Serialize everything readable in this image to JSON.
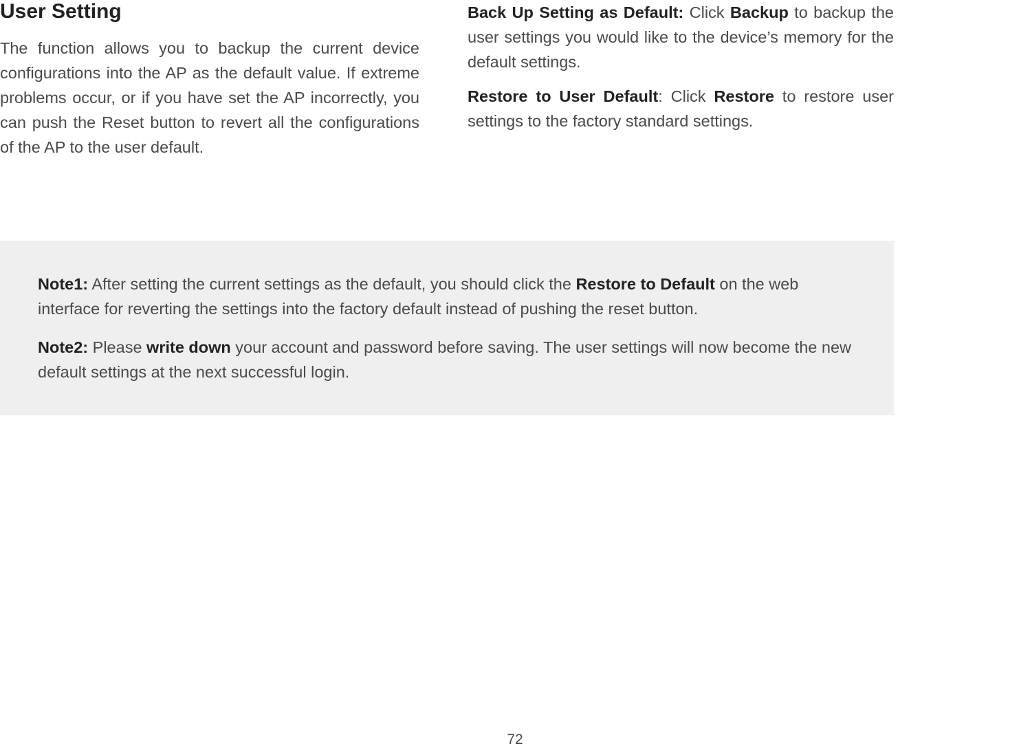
{
  "left": {
    "title": "User Setting",
    "para": "The function allows you to backup the current device configurations into the AP as the default value. If extreme problems occur, or if you have set the AP incorrectly, you can push the Reset button to revert all the configurations of the AP to the user default."
  },
  "right": {
    "p1_bold": "Back Up Setting as Default:",
    "p1_mid": "  Click ",
    "p1_bold2": "Backup",
    "p1_rest": " to backup the user settings you would like to the device’s memory for the default settings.",
    "p2_bold": "Restore to User Default",
    "p2_mid": ": Click ",
    "p2_bold2": "Restore",
    "p2_rest": " to restore user settings to the factory standard settings."
  },
  "notes": {
    "n1_label": "Note1:",
    "n1_a": " After setting the current settings as the default, you should click the ",
    "n1_bold": "Restore to Default",
    "n1_b": " on the web interface for reverting the settings into the factory default instead of pushing the reset button.",
    "n2_label": "Note2:",
    "n2_a": " Please ",
    "n2_bold": "write down",
    "n2_b": " your account and password before saving. The user settings will now become the new default settings at the next successful login."
  },
  "page_number": "72"
}
